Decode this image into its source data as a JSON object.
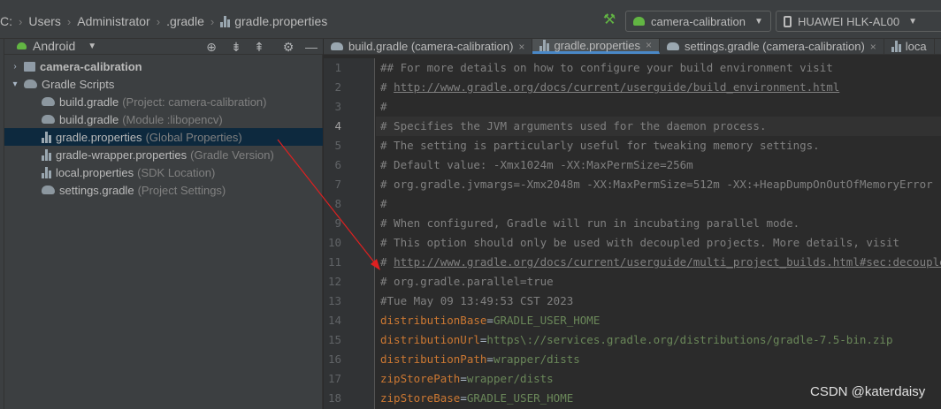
{
  "breadcrumb": {
    "drive": "C:",
    "items": [
      "Users",
      "Administrator",
      ".gradle"
    ],
    "file": "gradle.properties"
  },
  "toolbar": {
    "run_config": "camera-calibration",
    "device": "HUAWEI HLK-AL00"
  },
  "project_panel": {
    "view_mode": "Android",
    "tree": [
      {
        "label": "camera-calibration",
        "hint": "",
        "icon": "folder-icon",
        "level": 0,
        "expanded": false,
        "bold": true,
        "selected": false
      },
      {
        "label": "Gradle Scripts",
        "hint": "",
        "icon": "gradle-icon",
        "level": 0,
        "expanded": true,
        "bold": false,
        "selected": false
      },
      {
        "label": "build.gradle",
        "hint": "(Project: camera-calibration)",
        "icon": "gradle-icon",
        "level": 1,
        "bold": false,
        "selected": false
      },
      {
        "label": "build.gradle",
        "hint": "(Module :libopencv)",
        "icon": "gradle-icon",
        "level": 1,
        "bold": false,
        "selected": false
      },
      {
        "label": "gradle.properties",
        "hint": "(Global Properties)",
        "icon": "properties-icon",
        "level": 1,
        "bold": false,
        "selected": true
      },
      {
        "label": "gradle-wrapper.properties",
        "hint": "(Gradle Version)",
        "icon": "properties-icon",
        "level": 1,
        "bold": false,
        "selected": false
      },
      {
        "label": "local.properties",
        "hint": "(SDK Location)",
        "icon": "properties-icon",
        "level": 1,
        "bold": false,
        "selected": false
      },
      {
        "label": "settings.gradle",
        "hint": "(Project Settings)",
        "icon": "gradle-icon",
        "level": 1,
        "bold": false,
        "selected": false
      }
    ]
  },
  "editor_tabs": [
    {
      "label": "build.gradle (camera-calibration)",
      "icon": "gradle-icon",
      "active": false
    },
    {
      "label": "gradle.properties",
      "icon": "properties-icon",
      "active": true
    },
    {
      "label": "settings.gradle (camera-calibration)",
      "icon": "gradle-icon",
      "active": false
    },
    {
      "label": "loca",
      "icon": "properties-icon",
      "active": false
    }
  ],
  "editor": {
    "current_line": 4,
    "lines": [
      {
        "n": "1",
        "type": "comment",
        "text": "## For more details on how to configure your build environment visit"
      },
      {
        "n": "2",
        "type": "url",
        "prefix": "# ",
        "text": "http://www.gradle.org/docs/current/userguide/build_environment.html"
      },
      {
        "n": "3",
        "type": "comment",
        "text": "#"
      },
      {
        "n": "4",
        "type": "comment",
        "text": "# Specifies the JVM arguments used for the daemon process."
      },
      {
        "n": "5",
        "type": "comment",
        "text": "# The setting is particularly useful for tweaking memory settings."
      },
      {
        "n": "6",
        "type": "comment",
        "text": "# Default value: -Xmx1024m -XX:MaxPermSize=256m"
      },
      {
        "n": "7",
        "type": "comment",
        "text": "# org.gradle.jvmargs=-Xmx2048m -XX:MaxPermSize=512m -XX:+HeapDumpOnOutOfMemoryError"
      },
      {
        "n": "8",
        "type": "comment",
        "text": "#"
      },
      {
        "n": "9",
        "type": "comment",
        "text": "# When configured, Gradle will run in incubating parallel mode."
      },
      {
        "n": "10",
        "type": "comment",
        "text": "# This option should only be used with decoupled projects. More details, visit"
      },
      {
        "n": "11",
        "type": "url",
        "prefix": "# ",
        "text": "http://www.gradle.org/docs/current/userguide/multi_project_builds.html#sec:decoupled_projects"
      },
      {
        "n": "12",
        "type": "comment",
        "text": "# org.gradle.parallel=true"
      },
      {
        "n": "13",
        "type": "comment",
        "text": "#Tue May 09 13:49:53 CST 2023"
      },
      {
        "n": "14",
        "type": "prop",
        "key": "distributionBase",
        "value": "GRADLE_USER_HOME"
      },
      {
        "n": "15",
        "type": "prop",
        "key": "distributionUrl",
        "value": "https\\://services.gradle.org/distributions/gradle-7.5-bin.zip"
      },
      {
        "n": "16",
        "type": "prop",
        "key": "distributionPath",
        "value": "wrapper/dists"
      },
      {
        "n": "17",
        "type": "prop",
        "key": "zipStorePath",
        "value": "wrapper/dists"
      },
      {
        "n": "18",
        "type": "prop",
        "key": "zipStoreBase",
        "value": "GRADLE_USER_HOME"
      }
    ]
  },
  "watermark": "CSDN @katerdaisy",
  "colors": {
    "accent": "#4a88c7",
    "annotation_arrow": "#e02020",
    "property_key": "#cc7832",
    "property_value": "#6a8759",
    "comment": "#808080"
  }
}
